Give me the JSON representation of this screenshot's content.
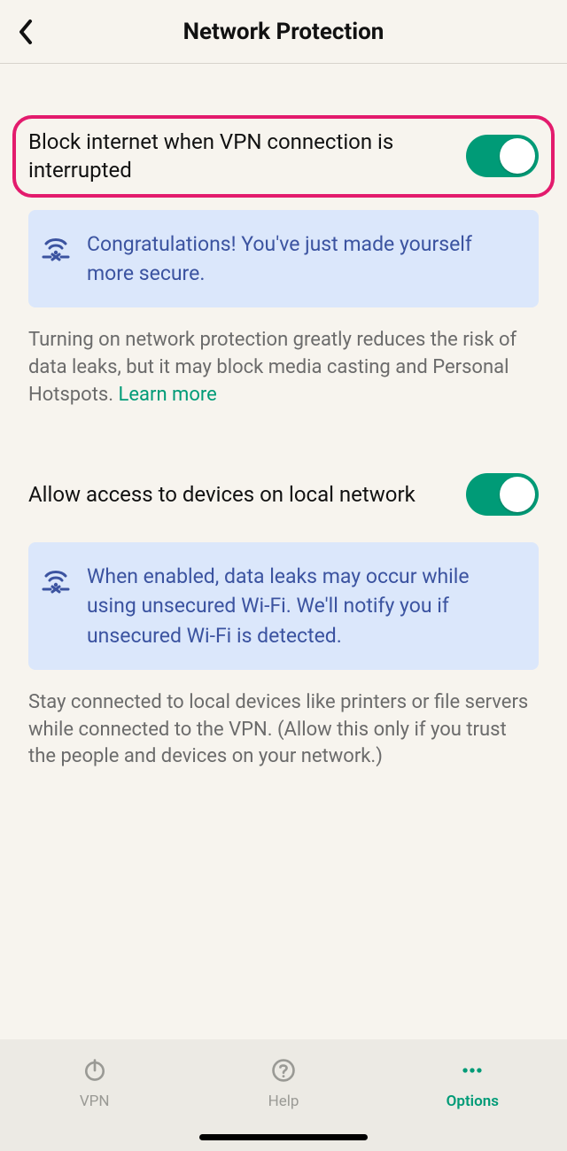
{
  "header": {
    "title": "Network Protection"
  },
  "settings": {
    "block_internet": {
      "label": "Block internet when VPN connection is interrupted",
      "banner": "Congratulations! You've just made yourself more secure.",
      "desc_pre": "Turning on network protection greatly reduces the risk of data leaks, but it may block media casting and Personal Hotspots. ",
      "learn_more": "Learn more"
    },
    "local_network": {
      "label": "Allow access to devices on local network",
      "banner": "When enabled, data leaks may occur while using unsecured Wi-Fi. We'll notify you if unsecured Wi-Fi is detected.",
      "desc": "Stay connected to local devices like printers or file servers while connected to the VPN. (Allow this only if you trust the people and devices on your network.)"
    }
  },
  "tabs": {
    "vpn": "VPN",
    "help": "Help",
    "options": "Options"
  }
}
